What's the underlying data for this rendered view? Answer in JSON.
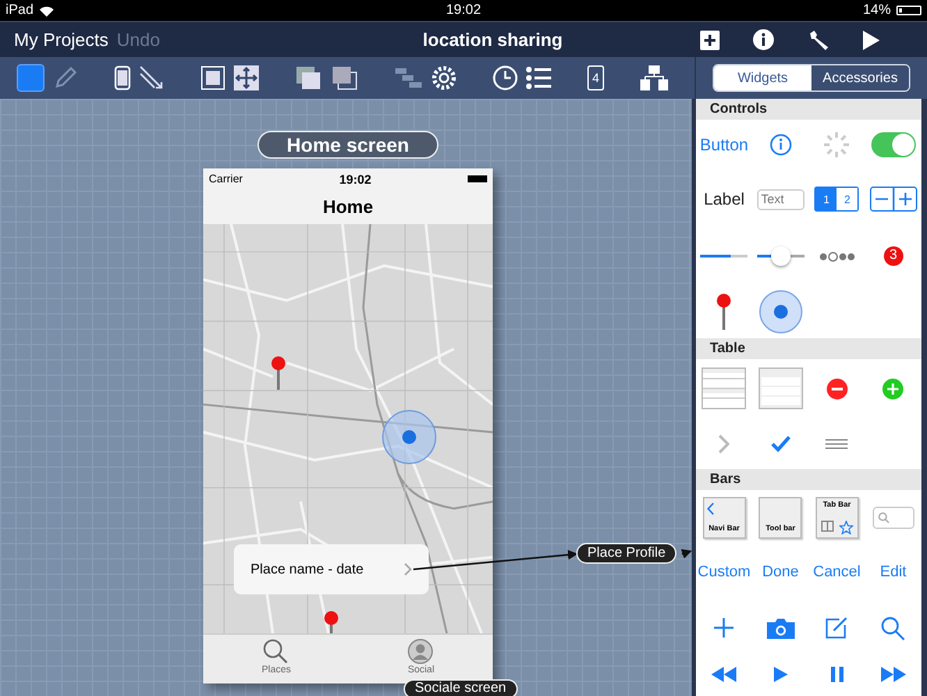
{
  "status_bar": {
    "device": "iPad",
    "time": "19:02",
    "battery": "14%"
  },
  "nav_bar": {
    "buttons": [
      {
        "label": "My Projects",
        "disabled": false
      },
      {
        "label": "Undo",
        "disabled": true
      }
    ],
    "title": "location sharing"
  },
  "toolbar": {
    "page_number": "4"
  },
  "panel": {
    "tabs": [
      {
        "label": "Widgets",
        "selected": true
      },
      {
        "label": "Accessories",
        "selected": false
      }
    ],
    "controls": {
      "title": "Controls",
      "button_label": "Button",
      "switch": {
        "on": true
      },
      "label_text": "Label",
      "text_placeholder": "Text",
      "segments": [
        {
          "label": "1",
          "selected": true
        },
        {
          "label": "2",
          "selected": false
        }
      ],
      "progress": {
        "level": 0.65
      },
      "slider": {
        "level": 0.5
      },
      "page_dots": [
        {
          "selected": false
        },
        {
          "selected": true
        },
        {
          "selected": false
        },
        {
          "selected": false
        }
      ],
      "badge": "3"
    },
    "table": {
      "title": "Table"
    },
    "bars": {
      "title": "Bars",
      "thumbnails": [
        "Navi Bar",
        "Tool bar",
        "Tab Bar"
      ],
      "bar_buttons": [
        "Custom",
        "Done",
        "Cancel",
        "Edit"
      ]
    }
  },
  "canvas": {
    "screen_label": "Home screen",
    "phone": {
      "carrier": "Carrier",
      "time": "19:02",
      "title": "Home",
      "callout": "Place name - date",
      "tabs": [
        {
          "label": "Places",
          "kind": "search"
        },
        {
          "label": "Social",
          "kind": "person"
        }
      ]
    },
    "links": [
      {
        "label": "Place Profile"
      },
      {
        "label": "Sociale screen"
      }
    ]
  }
}
